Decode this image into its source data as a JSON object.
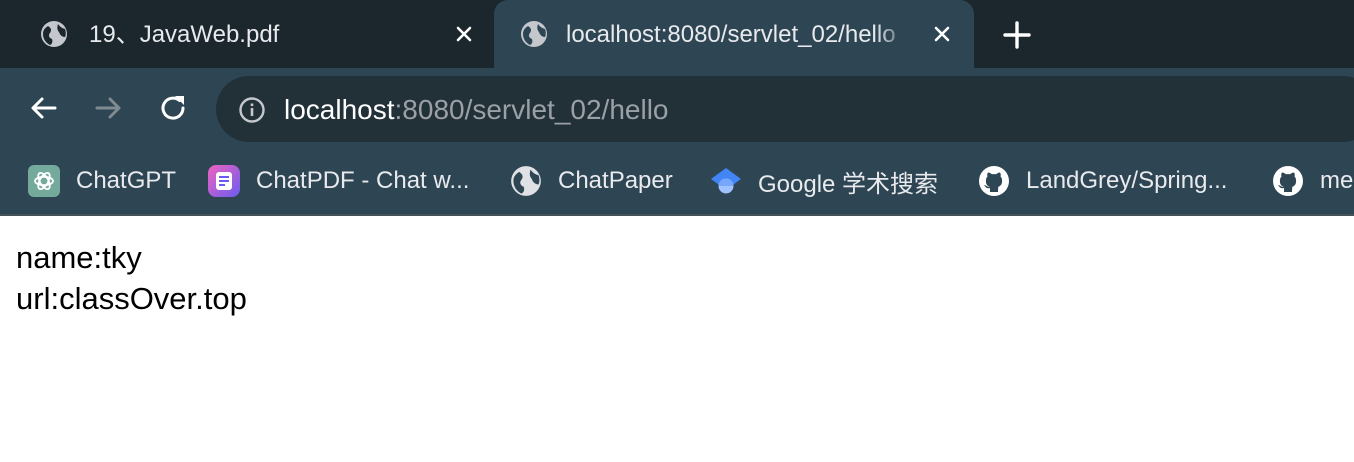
{
  "tabs": [
    {
      "title": "19、JavaWeb.pdf",
      "icon": "globe-icon",
      "active": false
    },
    {
      "title": "localhost:8080/servlet_02/hello",
      "icon": "globe-icon",
      "active": true
    }
  ],
  "toolbar": {
    "address": {
      "host": "localhost",
      "rest": ":8080/servlet_02/hello"
    }
  },
  "bookmarks": [
    {
      "label": "ChatGPT",
      "icon": "chatgpt-icon"
    },
    {
      "label": "ChatPDF - Chat w...",
      "icon": "chatpdf-icon"
    },
    {
      "label": "ChatPaper",
      "icon": "globe-icon"
    },
    {
      "label": "Google 学术搜索",
      "icon": "google-scholar-icon"
    },
    {
      "label": "LandGrey/Spring...",
      "icon": "github-icon"
    },
    {
      "label": "me",
      "icon": "github-icon"
    }
  ],
  "page": {
    "lines": [
      "name:tky",
      "url:classOver.top"
    ]
  },
  "colors": {
    "tabstrip_bg": "#1c262d",
    "toolbar_bg": "#2e4554",
    "omnibox_bg": "#223038",
    "text_light": "#e8eaed",
    "url_dim": "#9aa0a6"
  }
}
